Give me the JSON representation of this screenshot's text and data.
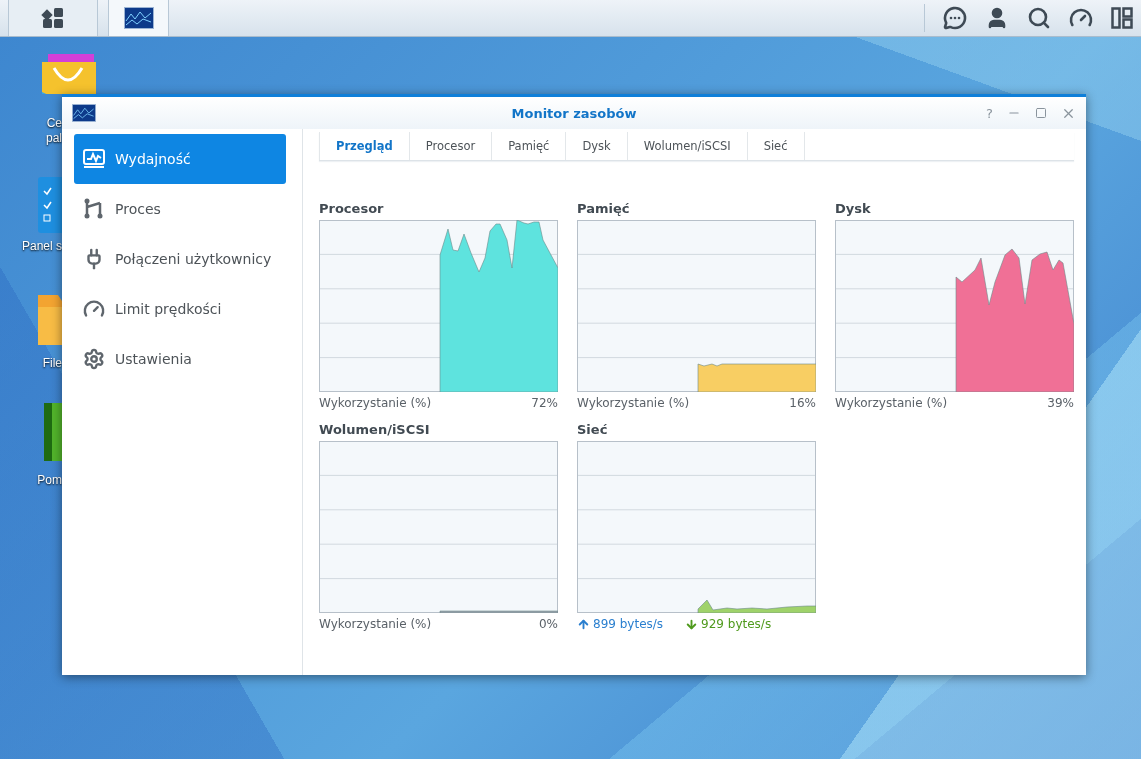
{
  "taskbar": {
    "buttons": [
      {
        "kind": "main-menu",
        "selected": false
      },
      {
        "kind": "resource-monitor",
        "selected": true
      }
    ],
    "tray": [
      {
        "kind": "chat"
      },
      {
        "kind": "user"
      },
      {
        "kind": "search"
      },
      {
        "kind": "gauge"
      },
      {
        "kind": "widgets"
      }
    ]
  },
  "desktop_icons": [
    {
      "kind": "package",
      "lines": [
        "Ce",
        "pal"
      ]
    },
    {
      "kind": "panel",
      "lines": [
        "Panel s"
      ]
    },
    {
      "kind": "folder",
      "lines": [
        "File"
      ]
    },
    {
      "kind": "book",
      "lines": [
        "Pom"
      ]
    }
  ],
  "window": {
    "title": "Monitor zasobów",
    "help": "?"
  },
  "sidebar": {
    "items": [
      {
        "kind": "performance",
        "label": "Wydajność",
        "selected": true
      },
      {
        "kind": "process",
        "label": "Proces",
        "selected": false
      },
      {
        "kind": "connections",
        "label": "Połączeni użytkownicy",
        "selected": false
      },
      {
        "kind": "speed",
        "label": "Limit prędkości",
        "selected": false
      },
      {
        "kind": "settings",
        "label": "Ustawienia",
        "selected": false
      }
    ]
  },
  "tabs": [
    {
      "label": "Przegląd",
      "selected": true
    },
    {
      "label": "Procesor",
      "selected": false
    },
    {
      "label": "Pamięć",
      "selected": false
    },
    {
      "label": "Dysk",
      "selected": false
    },
    {
      "label": "Wolumen/iSCSI",
      "selected": false
    },
    {
      "label": "Sieć",
      "selected": false
    }
  ],
  "charts": [
    {
      "kind": "usage",
      "title": "Procesor",
      "color": "#5ee3de",
      "label": "Wykorzystanie (%)",
      "value": "72%"
    },
    {
      "kind": "usage",
      "title": "Pamięć",
      "color": "#f8ce63",
      "label": "Wykorzystanie (%)",
      "value": "16%"
    },
    {
      "kind": "usage",
      "title": "Dysk",
      "color": "#f07096",
      "label": "Wykorzystanie (%)",
      "value": "39%"
    },
    {
      "kind": "usage",
      "title": "Wolumen/iSCSI",
      "color": "#9aa3ad",
      "label": "Wykorzystanie (%)",
      "value": "0%"
    },
    {
      "kind": "network",
      "title": "Sieć",
      "color": "#9fd26a",
      "upload": "899 bytes/s",
      "download": "929 bytes/s"
    }
  ]
}
